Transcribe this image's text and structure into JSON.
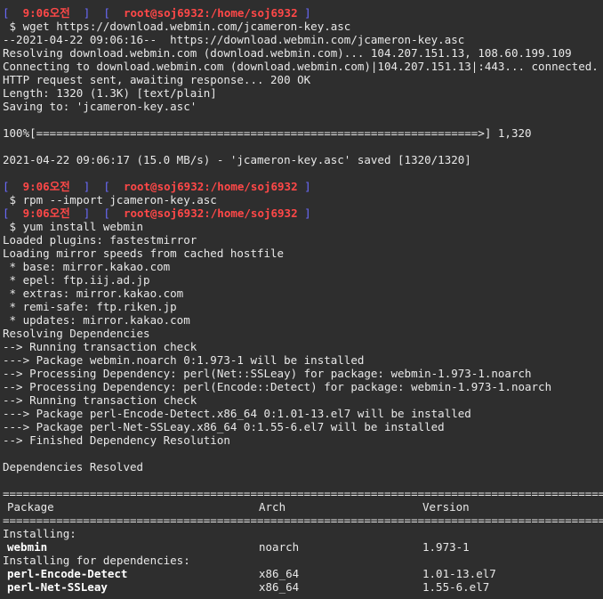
{
  "prompt": {
    "open": "[",
    "time": "9:06오전",
    "user": "root@soj6932:/home/soj6932",
    "close": "]"
  },
  "wget_block": {
    "cmd": " $ wget https://download.webmin.com/jcameron-key.asc",
    "l1": "--2021-04-22 09:06:16--  https://download.webmin.com/jcameron-key.asc",
    "l2": "Resolving download.webmin.com (download.webmin.com)... 104.207.151.13, 108.60.199.109",
    "l3": "Connecting to download.webmin.com (download.webmin.com)|104.207.151.13|:443... connected.",
    "l4": "HTTP request sent, awaiting response... 200 OK",
    "l5": "Length: 1320 (1.3K) [text/plain]",
    "l6": "Saving to: 'jcameron-key.asc'",
    "progress": "100%[==================================================================>] 1,320",
    "saved": "2021-04-22 09:06:17 (15.0 MB/s) - 'jcameron-key.asc' saved [1320/1320]"
  },
  "rpm_cmd": " $ rpm --import jcameron-key.asc",
  "yum_block": {
    "cmd": " $ yum install webmin",
    "lines": [
      "Loaded plugins: fastestmirror",
      "Loading mirror speeds from cached hostfile",
      " * base: mirror.kakao.com",
      " * epel: ftp.iij.ad.jp",
      " * extras: mirror.kakao.com",
      " * remi-safe: ftp.riken.jp",
      " * updates: mirror.kakao.com",
      "Resolving Dependencies",
      "--> Running transaction check",
      "---> Package webmin.noarch 0:1.973-1 will be installed",
      "--> Processing Dependency: perl(Net::SSLeay) for package: webmin-1.973-1.noarch",
      "--> Processing Dependency: perl(Encode::Detect) for package: webmin-1.973-1.noarch",
      "--> Running transaction check",
      "---> Package perl-Encode-Detect.x86_64 0:1.01-13.el7 will be installed",
      "---> Package perl-Net-SSLeay.x86_64 0:1.55-6.el7 will be installed",
      "--> Finished Dependency Resolution"
    ],
    "resolved": "Dependencies Resolved",
    "rule": "==========================================================================================",
    "headers": {
      "package": "Package",
      "arch": "Arch",
      "version": "Version"
    },
    "installing": "Installing:",
    "pkg1": {
      "name": "webmin",
      "arch": "noarch",
      "version": "1.973-1"
    },
    "installing_deps": "Installing for dependencies:",
    "pkg2": {
      "name": "perl-Encode-Detect",
      "arch": "x86_64",
      "version": "1.01-13.el7"
    },
    "pkg3": {
      "name": "perl-Net-SSLeay",
      "arch": "x86_64",
      "version": "1.55-6.el7"
    }
  }
}
